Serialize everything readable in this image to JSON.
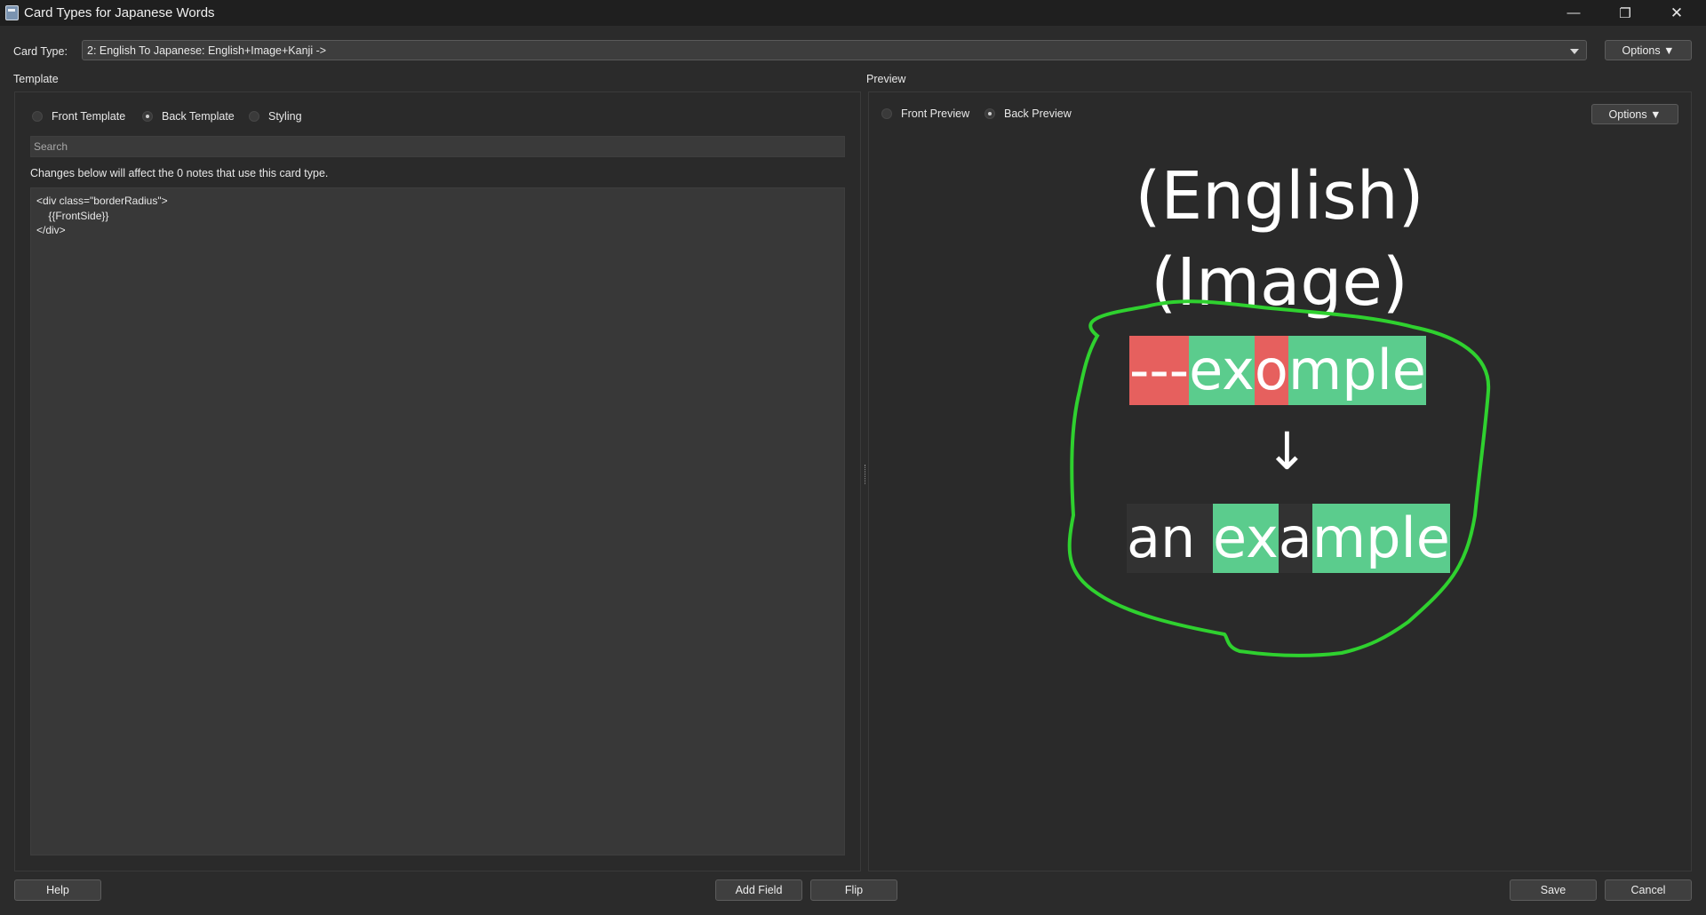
{
  "window": {
    "title": "Card Types for Japanese Words"
  },
  "card_type": {
    "label": "Card Type:",
    "selected": "2: English To Japanese: English+Image+Kanji ->",
    "options_label": "Options ▼"
  },
  "template": {
    "section_label": "Template",
    "tabs": [
      {
        "label": "Front Template",
        "selected": false
      },
      {
        "label": "Back Template",
        "selected": true
      },
      {
        "label": "Styling",
        "selected": false
      }
    ],
    "search_placeholder": "Search",
    "notice": "Changes below will affect the 0 notes that use this card type.",
    "code_lines": [
      "<div class=\"borderRadius\">",
      "    {{FrontSide}}",
      "</div>"
    ]
  },
  "preview": {
    "section_label": "Preview",
    "tabs": [
      {
        "label": "Front Preview",
        "selected": false
      },
      {
        "label": "Back Preview",
        "selected": true
      }
    ],
    "options_label": "Options ▼",
    "card": {
      "line1": "(English)",
      "line2": "(Image)",
      "typed_answer": [
        {
          "text": "---",
          "status": "bad"
        },
        {
          "text": "ex",
          "status": "good"
        },
        {
          "text": "o",
          "status": "bad"
        },
        {
          "text": "mple",
          "status": "good"
        }
      ],
      "arrow": "↓",
      "correct_answer": [
        {
          "text": "an",
          "status": "neutral"
        },
        {
          "text": " ",
          "status": "neutral"
        },
        {
          "text": "ex",
          "status": "good"
        },
        {
          "text": "a",
          "status": "neutral"
        },
        {
          "text": "mple",
          "status": "good"
        }
      ]
    }
  },
  "buttons": {
    "help": "Help",
    "add_field": "Add Field",
    "flip": "Flip",
    "save": "Save",
    "cancel": "Cancel"
  },
  "colors": {
    "bad": "#e6605e",
    "good": "#5bcc8d",
    "annotation": "#2fd12f"
  }
}
